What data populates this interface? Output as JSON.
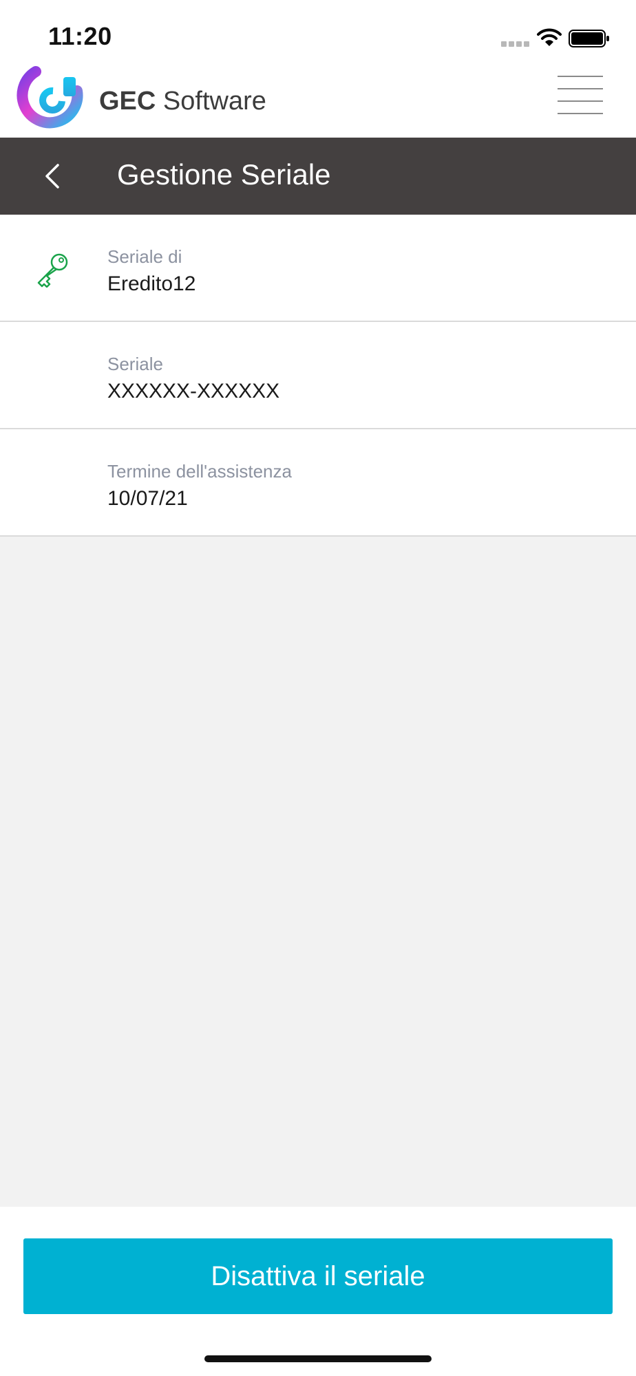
{
  "status_bar": {
    "time": "11:20",
    "icons": [
      "signal-icon",
      "wifi-icon",
      "battery-icon"
    ]
  },
  "brand": {
    "name_bold": "GEC",
    "name_light": "Software",
    "logo_colors": [
      "#7b3fe4",
      "#e23fd0",
      "#18c6f0"
    ],
    "menu_icon": "hamburger-menu-icon"
  },
  "title_bar": {
    "back_icon": "chevron-left-icon",
    "title": "Gestione Seriale",
    "background": "#444040"
  },
  "details": [
    {
      "label": "Seriale di",
      "value": "Eredito12",
      "icon": "key-icon"
    },
    {
      "label": "Seriale",
      "value": "XXXXXX-XXXXXX"
    },
    {
      "label": "Termine dell'assistenza",
      "value": "10/07/21"
    }
  ],
  "action": {
    "label": "Disattiva il seriale",
    "color": "#00b1d2"
  },
  "colors": {
    "key_icon": "#1aa34a",
    "label_text": "#8c92a0",
    "content_background": "#f2f2f2"
  }
}
